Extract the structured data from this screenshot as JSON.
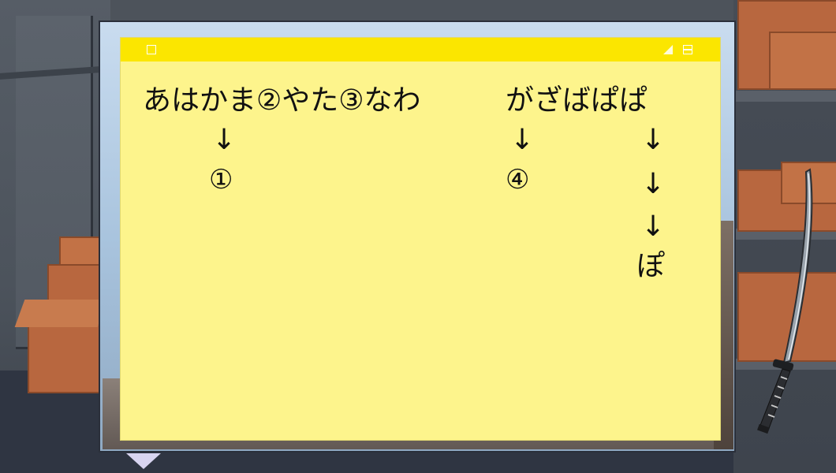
{
  "note": {
    "line1_left": "あはかま②やた③なわ",
    "line1_right": "がざばぱぱ",
    "arrow_a": "↓",
    "label_1": "①",
    "arrow_b": "↓",
    "label_4": "④",
    "arrow_c1": "↓",
    "arrow_c2": "↓",
    "arrow_c3": "↓",
    "final_char": "ぽ"
  },
  "colors": {
    "note_body": "#fdf48c",
    "note_titlebar": "#fbe600",
    "window_frame": "#a9c4de",
    "cardboard": "#b8673f"
  },
  "icons": {
    "new_note": "square-icon",
    "resize": "resize-grip-icon",
    "maximize": "window-icon",
    "prop": "katana-icon"
  }
}
